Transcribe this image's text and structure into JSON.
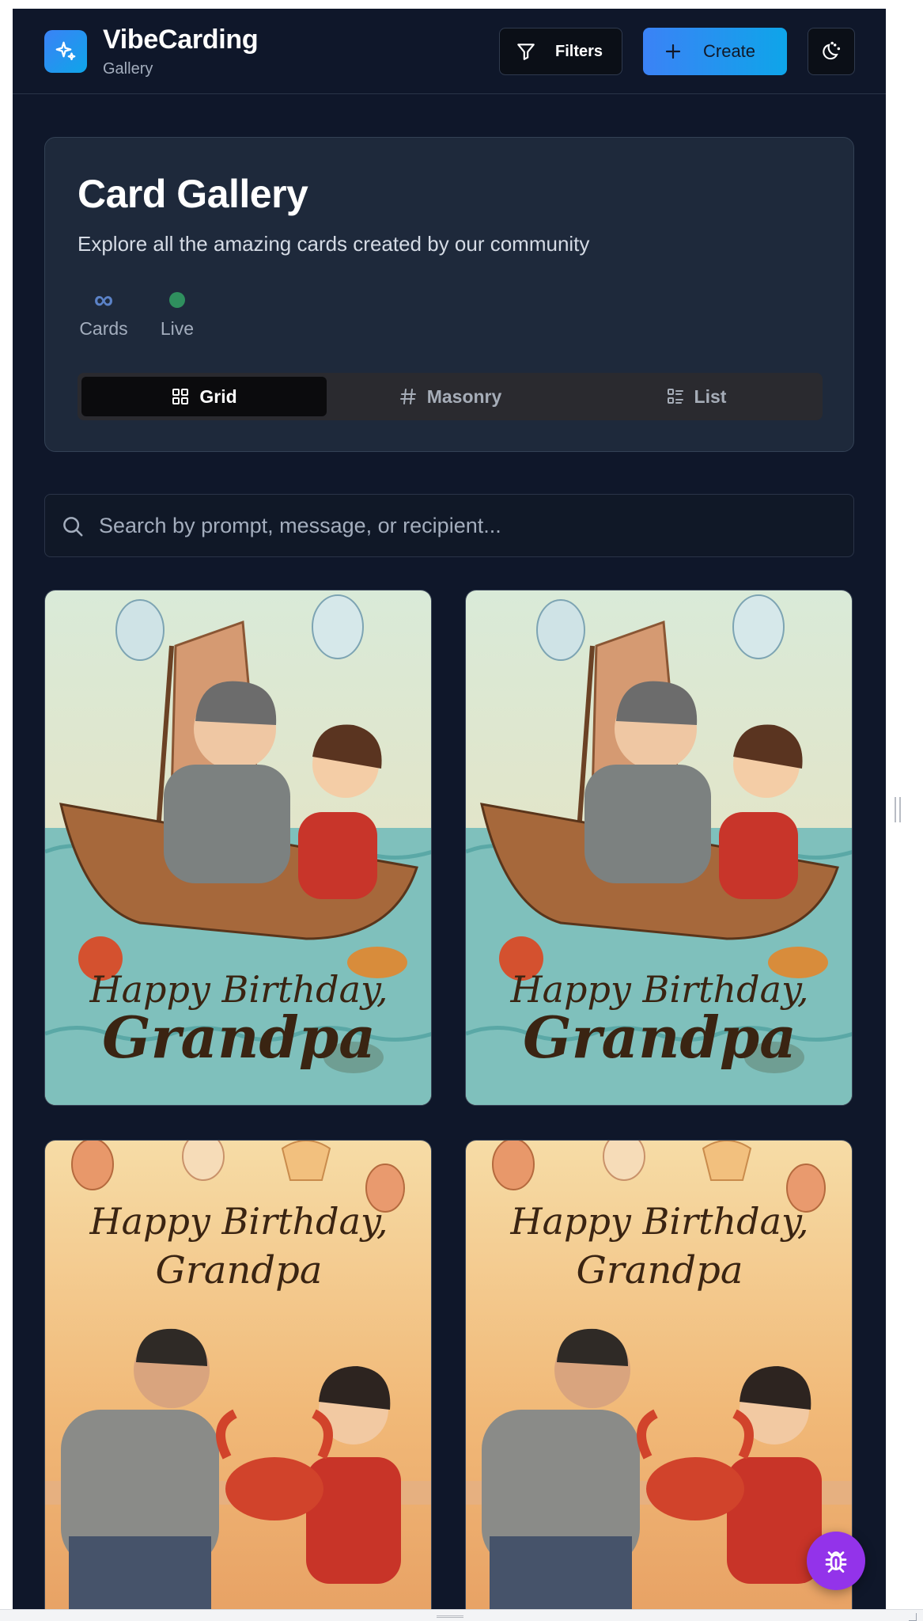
{
  "header": {
    "brand": "VibeCarding",
    "subtitle": "Gallery",
    "filters_label": "Filters",
    "create_label": "Create",
    "icons": [
      "sparkles-icon",
      "filter-icon",
      "plus-icon",
      "moon-icon"
    ]
  },
  "hero": {
    "title": "Card Gallery",
    "subtitle": "Explore all the amazing cards created by our community",
    "stats": [
      {
        "icon": "infinity-icon",
        "label": "Cards"
      },
      {
        "icon": "live-dot-icon",
        "label": "Live"
      }
    ],
    "views": [
      {
        "label": "Grid",
        "icon": "grid-icon",
        "active": true
      },
      {
        "label": "Masonry",
        "icon": "hash-icon",
        "active": false
      },
      {
        "label": "List",
        "icon": "list-icon",
        "active": false
      }
    ]
  },
  "search": {
    "placeholder": "Search by prompt, message, or recipient...",
    "value": ""
  },
  "cards": [
    {
      "line1": "Happy Birthday,",
      "line2": "Grandpa",
      "style": "boat-sea"
    },
    {
      "line1": "Happy Birthday,",
      "line2": "Grandpa",
      "style": "boat-sea"
    },
    {
      "line1": "Happy Birthday,",
      "line2": "Grandpa",
      "style": "crab-sunset"
    },
    {
      "line1": "Happy Birthday,",
      "line2": "Grandpa",
      "style": "crab-sunset"
    }
  ],
  "colors": {
    "background": "#0f172a",
    "panel": "#1e293b",
    "accent_gradient_start": "#3b82f6",
    "accent_gradient_end": "#0ea5e9",
    "fab": "#9333ea"
  },
  "fab_icon": "bug-icon"
}
